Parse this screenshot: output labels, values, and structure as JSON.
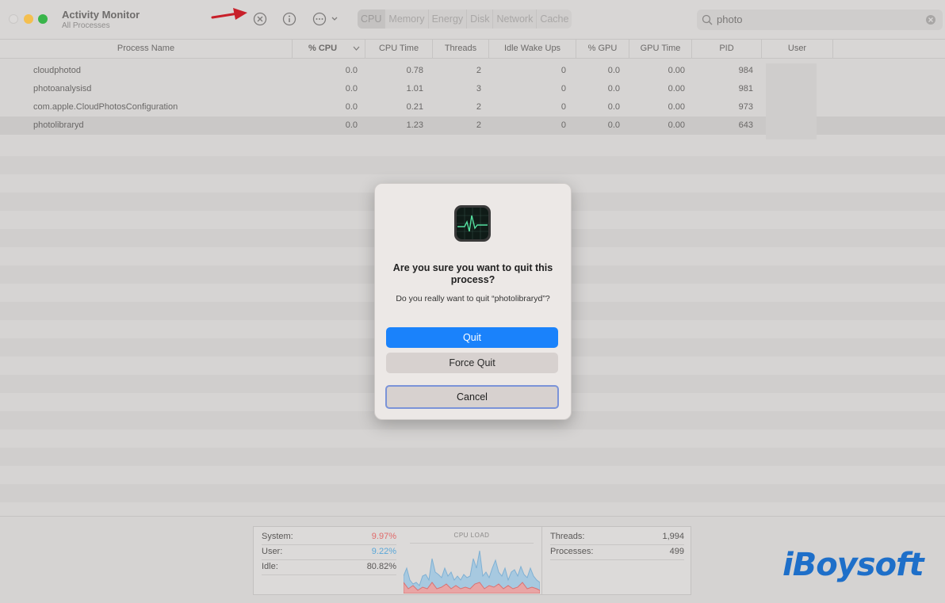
{
  "window": {
    "title": "Activity Monitor",
    "subtitle": "All Processes"
  },
  "toolbar": {
    "tabs": [
      "CPU",
      "Memory",
      "Energy",
      "Disk",
      "Network",
      "Cache"
    ],
    "active_tab": "CPU",
    "search_value": "photo",
    "icons": {
      "stop": "stop-process-icon",
      "info": "info-icon",
      "more": "more-options-icon"
    }
  },
  "table": {
    "columns": [
      "Process Name",
      "% CPU",
      "CPU Time",
      "Threads",
      "Idle Wake Ups",
      "% GPU",
      "GPU Time",
      "PID",
      "User"
    ],
    "rows": [
      {
        "name": "cloudphotod",
        "cpu": "0.0",
        "cpu_time": "0.78",
        "threads": "2",
        "idle_wake": "0",
        "gpu": "0.0",
        "gpu_time": "0.00",
        "pid": "984"
      },
      {
        "name": "photoanalysisd",
        "cpu": "0.0",
        "cpu_time": "1.01",
        "threads": "3",
        "idle_wake": "0",
        "gpu": "0.0",
        "gpu_time": "0.00",
        "pid": "981"
      },
      {
        "name": "com.apple.CloudPhotosConfiguration",
        "cpu": "0.0",
        "cpu_time": "0.21",
        "threads": "2",
        "idle_wake": "0",
        "gpu": "0.0",
        "gpu_time": "0.00",
        "pid": "973"
      },
      {
        "name": "photolibraryd",
        "cpu": "0.0",
        "cpu_time": "1.23",
        "threads": "2",
        "idle_wake": "0",
        "gpu": "0.0",
        "gpu_time": "0.00",
        "pid": "643"
      }
    ],
    "selected_row": 3
  },
  "dialog": {
    "title": "Are you sure you want to quit this process?",
    "message": "Do you really want to quit “photolibraryd”?",
    "quit_label": "Quit",
    "force_quit_label": "Force Quit",
    "cancel_label": "Cancel"
  },
  "stats": {
    "system_label": "System:",
    "system_value": "9.97%",
    "user_label": "User:",
    "user_value": "9.22%",
    "idle_label": "Idle:",
    "idle_value": "80.82%",
    "cpu_load_title": "CPU LOAD",
    "threads_label": "Threads:",
    "threads_value": "1,994",
    "processes_label": "Processes:",
    "processes_value": "499"
  },
  "colors": {
    "system": "#e06a6a",
    "user": "#5aa7d8",
    "accent": "#1a82fb"
  },
  "brand": "iBoysoft"
}
